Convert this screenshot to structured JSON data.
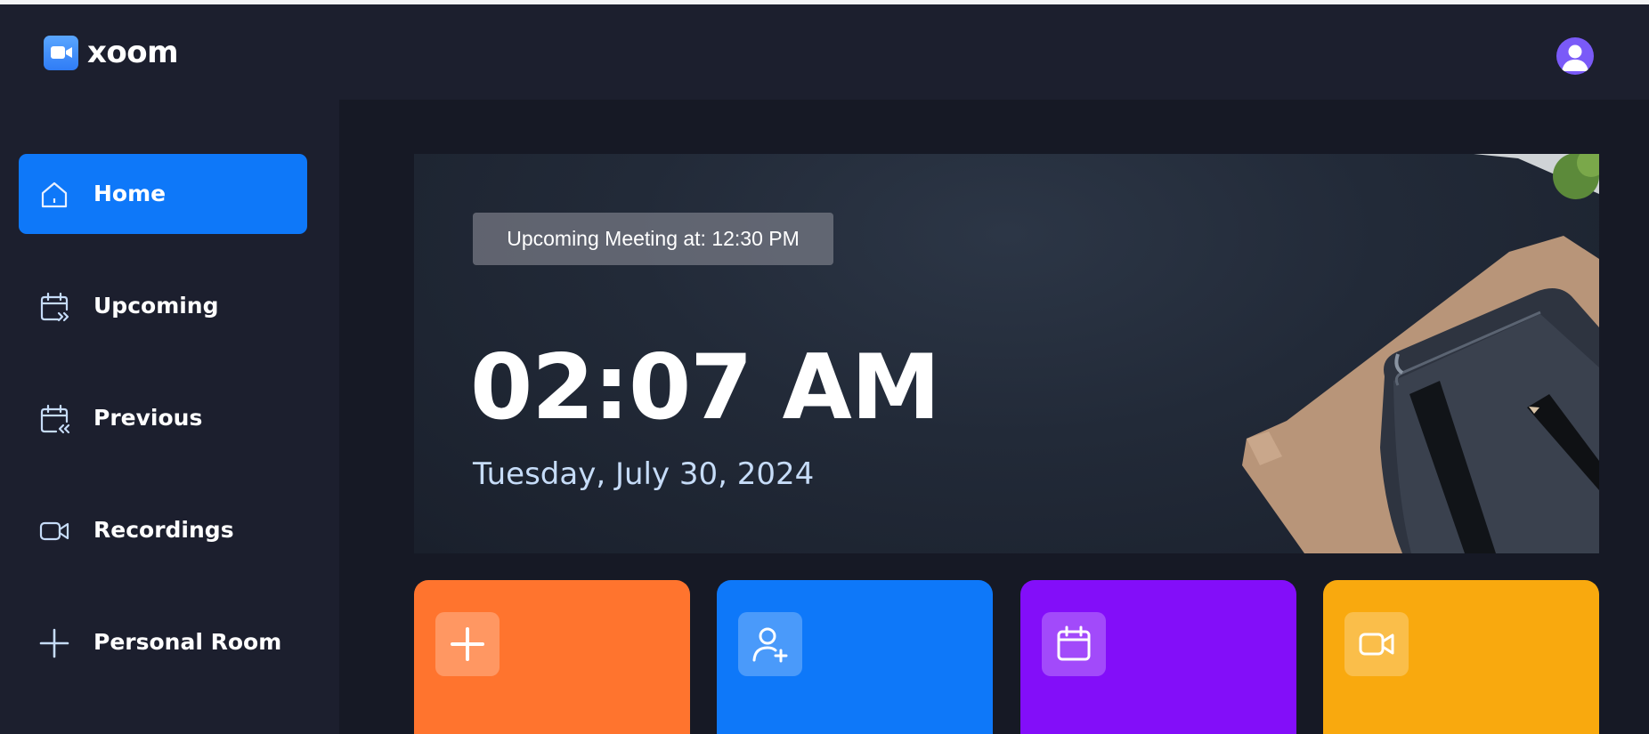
{
  "app": {
    "name": "xoom"
  },
  "sidebar": {
    "items": [
      {
        "label": "Home",
        "icon": "home-icon",
        "active": true
      },
      {
        "label": "Upcoming",
        "icon": "calendar-upcoming-icon",
        "active": false
      },
      {
        "label": "Previous",
        "icon": "calendar-previous-icon",
        "active": false
      },
      {
        "label": "Recordings",
        "icon": "video-icon",
        "active": false
      },
      {
        "label": "Personal Room",
        "icon": "plus-icon",
        "active": false
      }
    ]
  },
  "hero": {
    "upcoming_badge": "Upcoming Meeting at: 12:30 PM",
    "time": "02:07 AM",
    "date": "Tuesday, July 30, 2024"
  },
  "cards": [
    {
      "icon": "plus-icon",
      "color": "#ff742e"
    },
    {
      "icon": "user-plus-icon",
      "color": "#0e78f9"
    },
    {
      "icon": "calendar-icon",
      "color": "#830ef9"
    },
    {
      "icon": "video-icon",
      "color": "#f9a90e"
    }
  ],
  "colors": {
    "background": "#1c1f2e",
    "main_background": "#161925",
    "accent": "#0e78f9",
    "date_text": "#c6dcf8"
  }
}
